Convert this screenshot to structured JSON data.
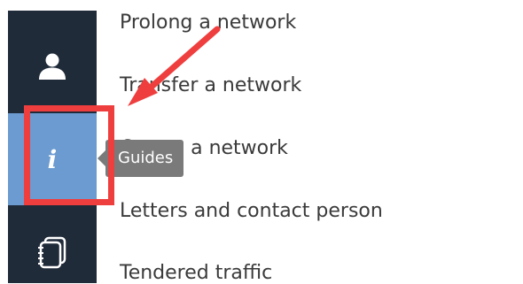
{
  "sidebar": {
    "items": [
      {
        "icon": "user-icon"
      },
      {
        "icon": "info-icon",
        "glyph": "i",
        "tooltip": "Guides",
        "active": true
      },
      {
        "icon": "notebook-icon"
      }
    ]
  },
  "menu": {
    "items": [
      "Prolong a network",
      "Transfer a network",
      "Create a network",
      "Letters and contact person",
      "Tendered traffic"
    ]
  },
  "annotation": {
    "color": "#ef3e3e"
  },
  "colors": {
    "sidebar_bg": "#202b3a",
    "active_bg": "#6b9bd0",
    "tooltip_bg": "#7a7a7a"
  }
}
